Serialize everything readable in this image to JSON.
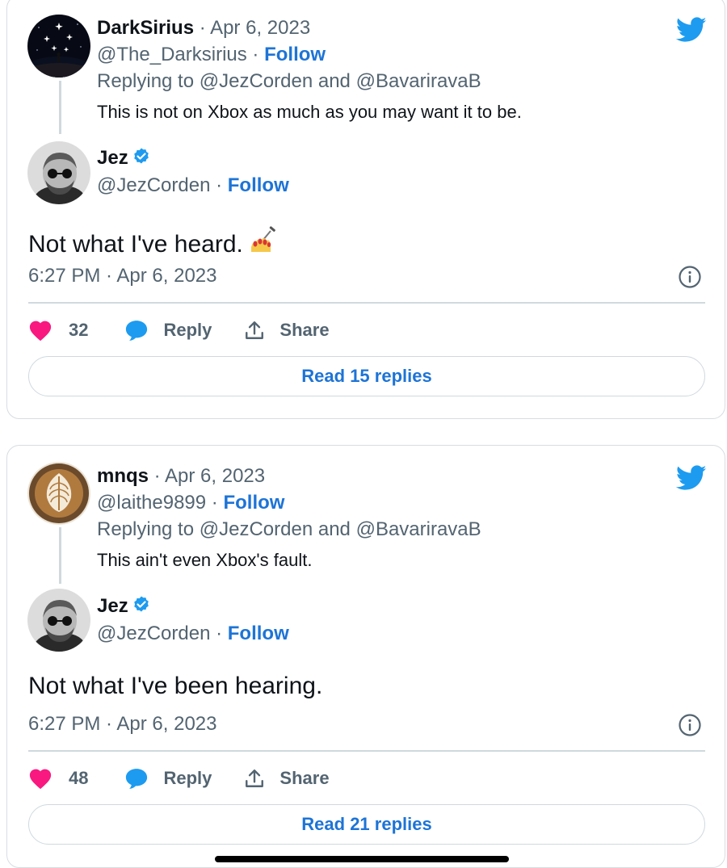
{
  "colors": {
    "accent": "#1d74d6",
    "twitter_blue": "#1d9bf0",
    "like_pink": "#f91880",
    "dim_text": "#536471",
    "border": "#cfd9de"
  },
  "cards": [
    {
      "parent": {
        "name": "DarkSirius",
        "date": "Apr 6, 2023",
        "handle": "@The_Darksirius",
        "follow_label": "Follow",
        "replying_prefix": "Replying to",
        "replying_user1": "@JezCorden",
        "replying_and": "and",
        "replying_user2": "@BavariravaB",
        "text": "This is not on Xbox as much as you may want it to be.",
        "avatar_icon": "starry-sky-avatar"
      },
      "reply": {
        "name": "Jez",
        "handle": "@JezCorden",
        "follow_label": "Follow",
        "text": "Not what I've heard.",
        "emoji_icon": "nail-polish-emoji",
        "time": "6:27 PM",
        "date": "Apr 6, 2023"
      },
      "likes": "32",
      "reply_label": "Reply",
      "share_label": "Share",
      "read_replies": "Read 15 replies"
    },
    {
      "parent": {
        "name": "mnqs",
        "date": "Apr 6, 2023",
        "handle": "@laithe9899",
        "follow_label": "Follow",
        "replying_prefix": "Replying to",
        "replying_user1": "@JezCorden",
        "replying_and": "and",
        "replying_user2": "@BavariravaB",
        "text": "This ain't even Xbox's fault.",
        "avatar_icon": "latte-art-avatar"
      },
      "reply": {
        "name": "Jez",
        "handle": "@JezCorden",
        "follow_label": "Follow",
        "text": "Not what I've been hearing.",
        "time": "6:27 PM",
        "date": "Apr 6, 2023"
      },
      "likes": "48",
      "reply_label": "Reply",
      "share_label": "Share",
      "read_replies": "Read 21 replies"
    }
  ]
}
